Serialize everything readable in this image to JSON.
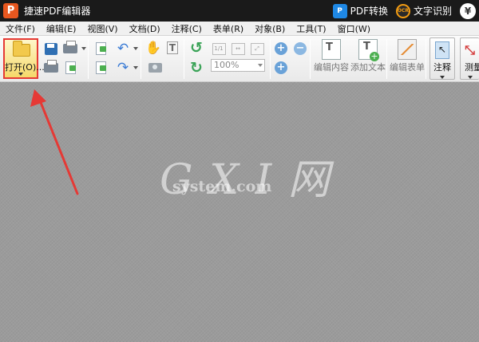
{
  "titlebar": {
    "logo_letter": "P",
    "app_title": "捷速PDF编辑器",
    "pdf_convert_icon": "P",
    "pdf_convert_label": "PDF转换",
    "ocr_icon": "OCR",
    "ocr_label": "文字识别",
    "price_icon": "¥"
  },
  "menu": {
    "items": [
      "文件(F)",
      "编辑(E)",
      "视图(V)",
      "文档(D)",
      "注释(C)",
      "表单(R)",
      "对象(B)",
      "工具(T)",
      "窗口(W)"
    ]
  },
  "toolbar": {
    "open_label": "打开(O)...",
    "page_indicator": "1/1",
    "zoom_value": "100%",
    "edit_content_label": "编辑内容",
    "add_text_label": "添加文本",
    "edit_form_label": "编辑表单",
    "annotate_label": "注释",
    "measure_label": "测量"
  },
  "watermark": {
    "logo": "G X I 网",
    "sub": "system.com"
  },
  "colors": {
    "titlebar_bg": "#1a1a1a",
    "app_logo": "#e8571f",
    "highlight_border": "#e53935",
    "annotation_arrow": "#e53935"
  }
}
